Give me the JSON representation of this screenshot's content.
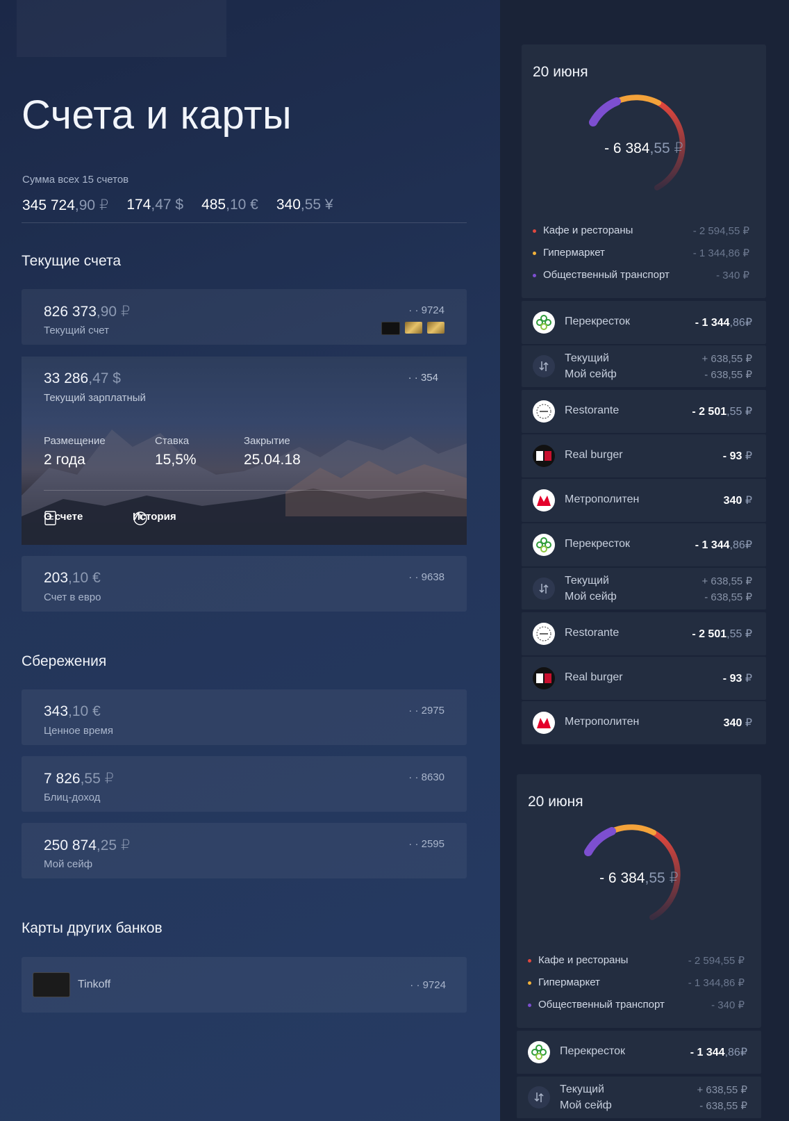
{
  "page": {
    "title": "Счета и карты",
    "sum_label": "Сумма всех 15 счетов",
    "totals": [
      {
        "int": "345 724",
        "frac": ",90 ₽"
      },
      {
        "int": "174",
        "frac": ",47 $"
      },
      {
        "int": "485",
        "frac": ",10 €"
      },
      {
        "int": "340",
        "frac": ",55 ¥"
      }
    ]
  },
  "current": {
    "heading": "Текущие счета",
    "accounts": [
      {
        "int": "826 373",
        "frac": ",90 ₽",
        "name": "Текущий счет",
        "num": "· · 9724"
      },
      {
        "int": "33 286",
        "frac": ",47 $",
        "name": "Текущий зарплатный",
        "num": "· · 354"
      },
      {
        "int": "203",
        "frac": ",10 €",
        "name": "Счет в евро",
        "num": "· · 9638"
      }
    ],
    "expanded": {
      "placement_label": "Размещение",
      "placement_value": "2 года",
      "rate_label": "Ставка",
      "rate_value": "15,5%",
      "close_label": "Закрытие",
      "close_value": "25.04.18",
      "about_label": "О счете",
      "history_label": "История"
    }
  },
  "savings": {
    "heading": "Сбережения",
    "accounts": [
      {
        "int": "343",
        "frac": ",10 €",
        "name": "Ценное время",
        "num": "· · 2975"
      },
      {
        "int": "7 826",
        "frac": ",55 ₽",
        "name": "Блиц-доход",
        "num": "· · 8630"
      },
      {
        "int": "250 874",
        "frac": ",25 ₽",
        "name": "Мой сейф",
        "num": "· · 2595"
      }
    ]
  },
  "other_banks": {
    "heading": "Карты других банков",
    "cards": [
      {
        "name": "Tinkoff",
        "num": "· · 9724"
      }
    ]
  },
  "widget": {
    "date": "20 июня",
    "total_int": "- 6 384",
    "total_frac": ",55 ₽",
    "legend": [
      {
        "label": "Кафе и рестораны",
        "value": "- 2 594,55 ₽",
        "color": "#e0483e"
      },
      {
        "label": "Гипермаркет",
        "value": "- 1 344,86 ₽",
        "color": "#f3b23a"
      },
      {
        "label": "Общественный транспорт",
        "value": "- 340 ₽",
        "color": "#7d4fd0"
      }
    ]
  },
  "transactions": [
    {
      "type": "single",
      "icon": "perekrestok-icon",
      "name": "Перекресток",
      "int": "- 1 344",
      "frac": ",86₽"
    },
    {
      "type": "double",
      "icon": "transfer-icon",
      "name": "Текущий",
      "name2": "Мой сейф",
      "v1": "+ 638,55 ₽",
      "v2": "- 638,55 ₽"
    },
    {
      "type": "single",
      "icon": "restorante-icon",
      "name": "Restorante",
      "int": "- 2 501",
      "frac": ",55 ₽"
    },
    {
      "type": "single",
      "icon": "real-burger-icon",
      "name": "Real burger",
      "int": "- 93",
      "frac": " ₽"
    },
    {
      "type": "single",
      "icon": "metro-icon",
      "name": "Метрополитен",
      "int": "340",
      "frac": " ₽"
    }
  ],
  "colors": {
    "accent_purple": "#7d4fd0",
    "accent_orange": "#f3a23a",
    "accent_red": "#d6443c"
  }
}
